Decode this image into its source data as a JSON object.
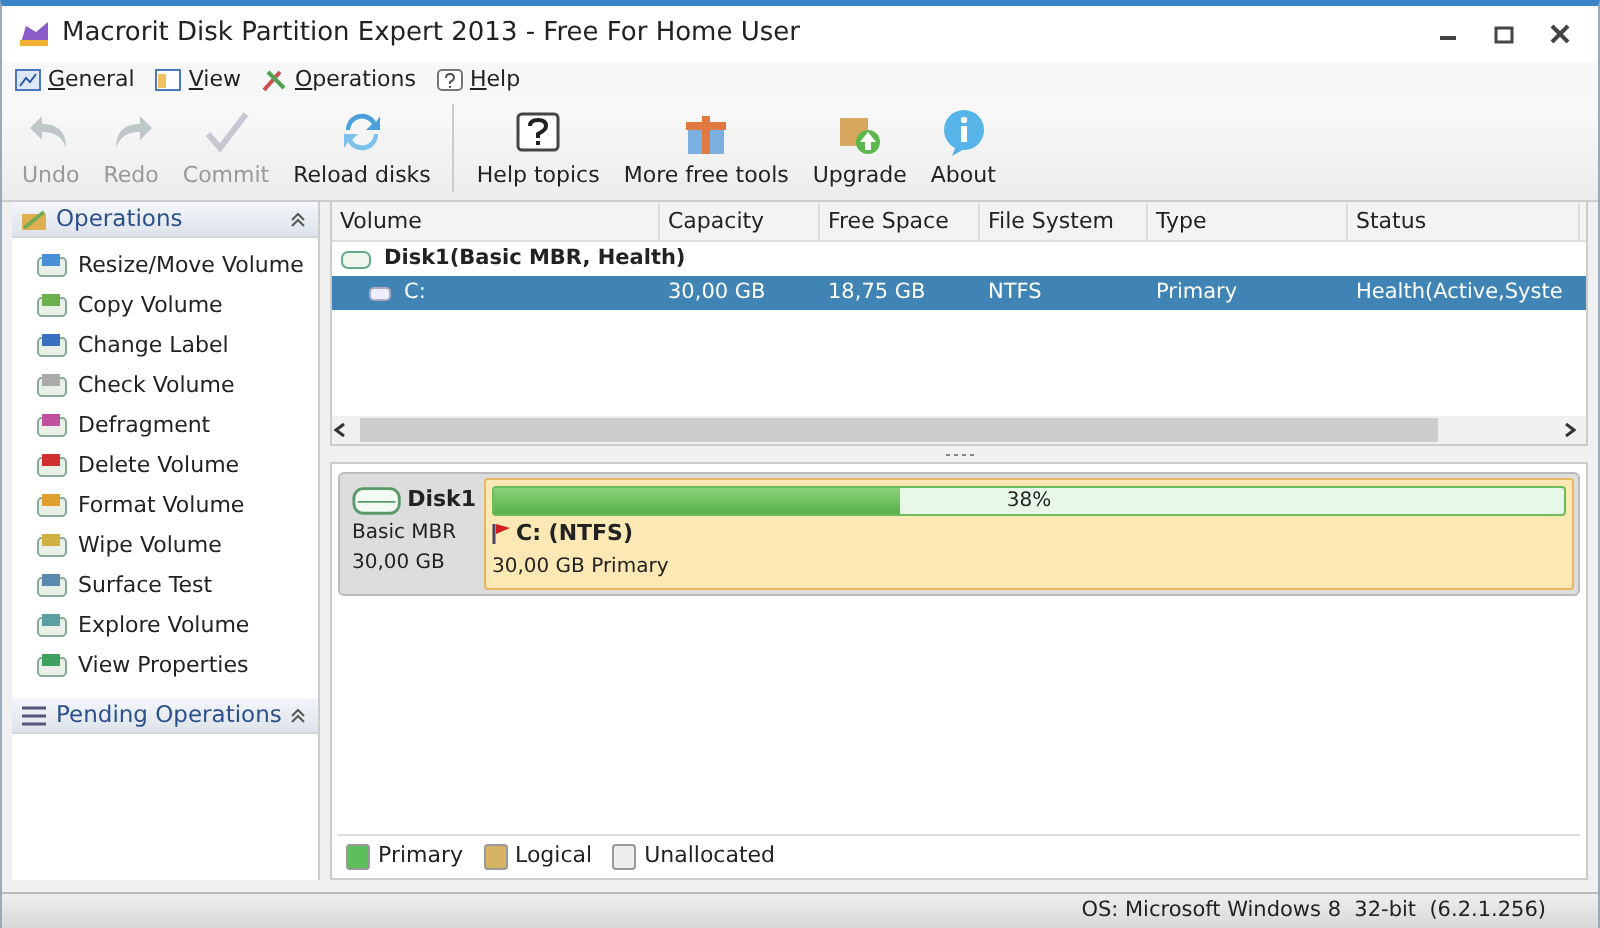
{
  "window": {
    "title": "Macrorit Disk Partition Expert 2013 - Free For Home User"
  },
  "menu": [
    {
      "label": "General"
    },
    {
      "label": "View"
    },
    {
      "label": "Operations"
    },
    {
      "label": "Help"
    }
  ],
  "toolbar": [
    {
      "label": "Undo",
      "disabled": true
    },
    {
      "label": "Redo",
      "disabled": true
    },
    {
      "label": "Commit",
      "disabled": true
    },
    {
      "label": "Reload disks",
      "disabled": false
    },
    {
      "label": "Help topics",
      "disabled": false
    },
    {
      "label": "More free tools",
      "disabled": false
    },
    {
      "label": "Upgrade",
      "disabled": false
    },
    {
      "label": "About",
      "disabled": false
    }
  ],
  "sidebar": {
    "sections": [
      {
        "title": "Operations",
        "items": [
          {
            "label": "Resize/Move Volume"
          },
          {
            "label": "Copy Volume"
          },
          {
            "label": "Change Label"
          },
          {
            "label": "Check Volume"
          },
          {
            "label": "Defragment"
          },
          {
            "label": "Delete Volume"
          },
          {
            "label": "Format Volume"
          },
          {
            "label": "Wipe Volume"
          },
          {
            "label": "Surface Test"
          },
          {
            "label": "Explore Volume"
          },
          {
            "label": "View Properties"
          }
        ]
      },
      {
        "title": "Pending Operations"
      }
    ]
  },
  "table": {
    "columns": [
      "Volume",
      "Capacity",
      "Free Space",
      "File System",
      "Type",
      "Status"
    ],
    "rows": [
      {
        "kind": "disk",
        "selected": false,
        "cells": [
          "Disk1(Basic MBR, Health)"
        ]
      },
      {
        "kind": "partition",
        "selected": true,
        "cells": [
          "C:",
          "30,00 GB",
          "18,75 GB",
          "NTFS",
          "Primary",
          "Health(Active,Syste"
        ]
      }
    ]
  },
  "disk_map": {
    "disks": [
      {
        "name": "Disk1",
        "type": "Basic MBR",
        "size": "30,00 GB",
        "partitions": [
          {
            "label": "C: (NTFS)",
            "detail": "30,00 GB Primary",
            "level": 0.38,
            "reading": "38%"
          }
        ]
      }
    ]
  },
  "legend": [
    {
      "label": "Primary",
      "color": "#5cbf5c"
    },
    {
      "label": "Logical",
      "color": "#d4b462"
    },
    {
      "label": "Unallocated",
      "color": "#eeeeee"
    }
  ],
  "status_bar": {
    "text": "OS: Microsoft Windows 8  32-bit  (6.2.1.256)"
  }
}
